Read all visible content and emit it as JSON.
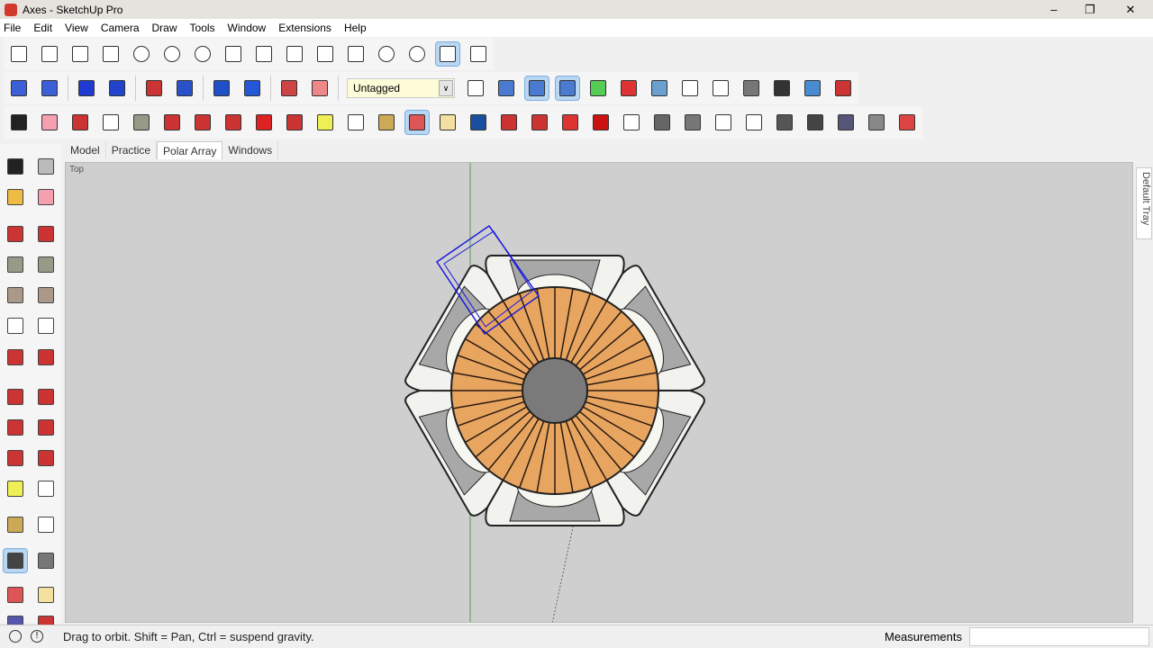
{
  "window": {
    "title": "Axes - SketchUp Pro"
  },
  "menu": [
    "File",
    "Edit",
    "View",
    "Camera",
    "Draw",
    "Tools",
    "Window",
    "Extensions",
    "Help"
  ],
  "tag_selector": {
    "value": "Untagged"
  },
  "scene_tabs": [
    {
      "label": "Model",
      "active": false
    },
    {
      "label": "Practice",
      "active": false
    },
    {
      "label": "Polar Array",
      "active": true
    },
    {
      "label": "Windows",
      "active": false
    }
  ],
  "viewport": {
    "view_label": "Top",
    "chair_count": 6,
    "slat_count": 36
  },
  "tray": {
    "label": "Default Tray"
  },
  "status": {
    "message": "Drag to orbit. Shift = Pan, Ctrl = suspend gravity.",
    "measurements_label": "Measurements",
    "measurements_value": ""
  },
  "colors": {
    "viewport": "#cfcfcf",
    "wood": "#e8a560",
    "selection": "#1a1adc",
    "tag_bg": "#fdfbd8"
  }
}
